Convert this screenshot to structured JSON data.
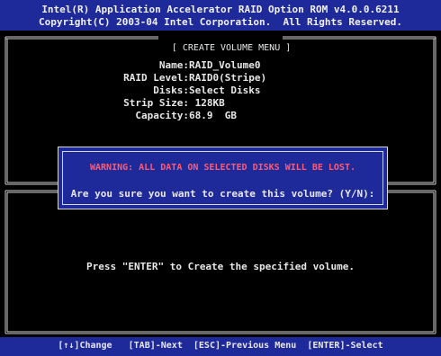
{
  "header": {
    "line1": "Intel(R) Application Accelerator RAID Option ROM v4.0.0.6211",
    "line2": "Copyright(C) 2003-04 Intel Corporation.  All Rights Reserved."
  },
  "create_volume_menu": {
    "title": "[ CREATE VOLUME MENU ]",
    "fields": [
      {
        "label": "Name:",
        "value": "RAID_Volume0"
      },
      {
        "label": "RAID Level:",
        "value": "RAID0(Stripe)"
      },
      {
        "label": "Disks:",
        "value": "Select Disks"
      },
      {
        "label": "Strip Size:",
        "value": " 128KB"
      },
      {
        "label": "Capacity:",
        "value": "68.9  GB"
      }
    ]
  },
  "dialog": {
    "warning": "WARNING: ALL DATA ON SELECTED DISKS WILL BE LOST.",
    "confirm": "Are you sure you want to create this volume? (Y/N):"
  },
  "help": {
    "text": "Press \"ENTER\" to Create the specified volume."
  },
  "status_bar": {
    "text": "[↑↓]Change   [TAB]-Next  [ESC]-Previous Menu  [ENTER]-Select"
  }
}
